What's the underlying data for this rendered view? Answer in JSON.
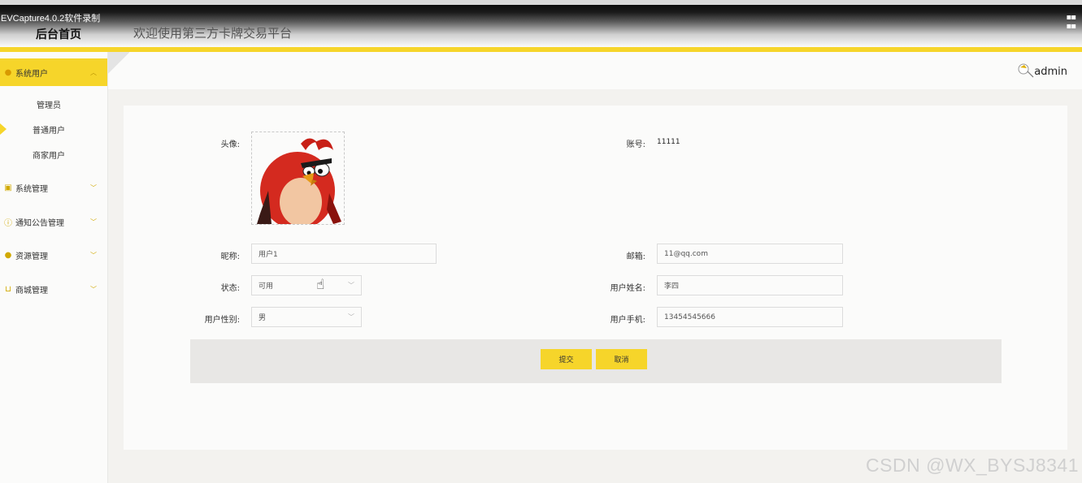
{
  "recorder_label": "EVCapture4.0.2软件录制",
  "header": {
    "brand": "后台首页",
    "welcome": "欢迎使用第三方卡牌交易平台",
    "user_name": "admin"
  },
  "sidebar": {
    "menus": [
      {
        "label": "系统用户",
        "icon": "person-icon",
        "expanded": true
      },
      {
        "label": "系统管理",
        "icon": "picture-icon",
        "expanded": false
      },
      {
        "label": "通知公告管理",
        "icon": "info-icon",
        "expanded": false
      },
      {
        "label": "资源管理",
        "icon": "location-icon",
        "expanded": false
      },
      {
        "label": "商城管理",
        "icon": "cart-icon",
        "expanded": false
      }
    ],
    "sub_items": [
      "管理员",
      "普通用户",
      "商家用户"
    ],
    "active_sub_item": "普通用户"
  },
  "form": {
    "avatar_label": "头像:",
    "account_label": "账号:",
    "account_value": "11111",
    "nickname_label": "昵称:",
    "nickname_value": "用户1",
    "email_label": "邮箱:",
    "email_value": "11@qq.com",
    "status_label": "状态:",
    "status_value": "可用",
    "name_label": "用户姓名:",
    "name_value": "李四",
    "gender_label": "用户性别:",
    "gender_value": "男",
    "phone_label": "用户手机:",
    "phone_value": "13454545666"
  },
  "actions": {
    "submit": "提交",
    "cancel": "取消"
  },
  "watermark": "CSDN @WX_BYSJ8341",
  "colors": {
    "accent": "#f6d52a",
    "header_dark": "#0c0c0c",
    "sidebar_bg": "#fbfbfa"
  }
}
